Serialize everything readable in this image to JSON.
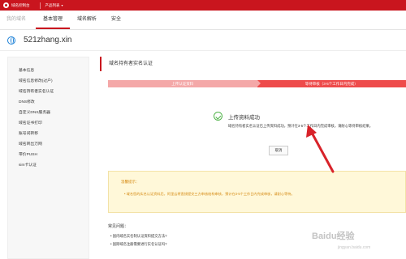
{
  "topbar": {
    "logo_text": "域名控制台",
    "product_menu": "产品列表",
    "caret": "▾",
    "brand_color": "#c9151e"
  },
  "nav": {
    "home": "我的域名",
    "tabs": [
      "基本管理",
      "域名解析",
      "安全"
    ]
  },
  "domain": {
    "name": "521zhang.xin"
  },
  "sidebar": {
    "items": [
      "基本信息",
      "域名信息修改(过户)",
      "域名持有者实名认证",
      "DNS修改",
      "自定义DNS服务器",
      "域名证书打印",
      "账号间转移",
      "域名转出万网",
      "带价PUSH",
      "sim卡认证"
    ]
  },
  "main": {
    "crumb": "域名持有者实名认证",
    "steps": [
      "上传认证资料",
      "等待审核（3-5个工作日内完成）"
    ],
    "success_title": "上传资料成功",
    "success_desc": "域名持有者实名认证已上传资料成功，预计在3-5个工作日内完成审核，请耐心等待审核结果。",
    "cancel_label": "取消",
    "notice_title": "温馨提示：",
    "notice_text": "• 域名您的实名认证资料后，阿里云将直接提交三方审核结构审核，预计在3-5个工作日内完成审核，请耐心等待。",
    "faq_title": "常见问题：",
    "faq_items": [
      "• 国内域名实名制认证资料提交方法?",
      "• 国际域名注册需要进行实名认证吗?"
    ]
  },
  "watermark": {
    "main": "Baidu经验",
    "sub": "jingyan.baidu.com"
  }
}
